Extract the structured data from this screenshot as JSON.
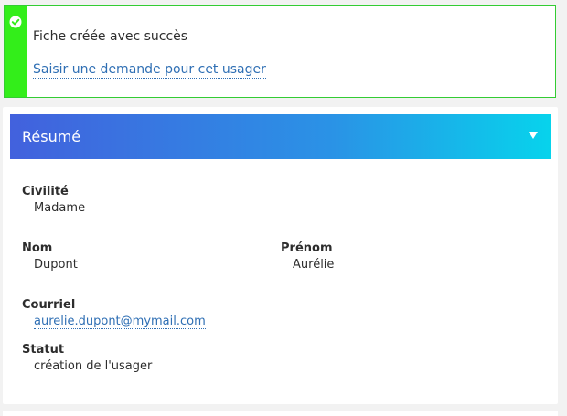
{
  "notice": {
    "message": "Fiche créée avec succès",
    "link_label": "Saisir une demande pour cet usager",
    "icon": "check-circle-icon",
    "stripe_color": "#33ee1a"
  },
  "summary": {
    "title": "Résumé",
    "toggle_icon": "triangle-down-icon",
    "gradient_colors": [
      "#4261dd",
      "#07d3ec"
    ],
    "fields": {
      "civilite": {
        "label": "Civilité",
        "value": "Madame"
      },
      "nom": {
        "label": "Nom",
        "value": "Dupont"
      },
      "prenom": {
        "label": "Prénom",
        "value": "Aurélie"
      },
      "courriel": {
        "label": "Courriel",
        "value": "aurelie.dupont@mymail.com"
      },
      "statut": {
        "label": "Statut",
        "value": "création de l'usager"
      }
    }
  }
}
